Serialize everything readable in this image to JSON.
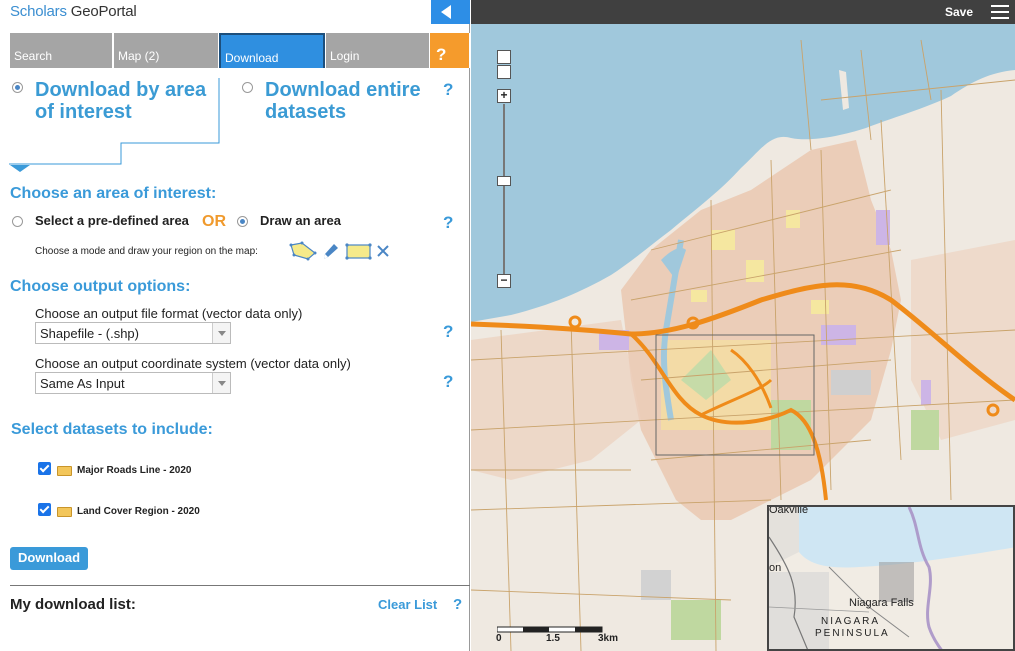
{
  "app": {
    "logo_part1": "Scholars",
    "logo_part2": " Geo",
    "logo_part3": "Portal"
  },
  "tabs": [
    {
      "label": "Search"
    },
    {
      "label": "Map (2)"
    },
    {
      "label": "Download"
    },
    {
      "label": "Login"
    },
    {
      "label": "?"
    }
  ],
  "download_mode": {
    "option1_line1": "Download by area",
    "option1_line2": "of interest",
    "option2_line1": "Download entire",
    "option2_line2": "datasets",
    "selected": "area"
  },
  "area": {
    "heading": "Choose an area of interest:",
    "predefined_label": "Select a pre-defined area",
    "or_label": "OR",
    "draw_label": "Draw an area",
    "mode_prompt": "Choose a mode and draw your region on the map:",
    "selected": "draw"
  },
  "output": {
    "heading": "Choose output options:",
    "format_label": "Choose an output file format (vector data only)",
    "format_value": "Shapefile - (.shp)",
    "crs_label": "Choose an output coordinate system (vector data only)",
    "crs_value": "Same As Input"
  },
  "datasets": {
    "heading": "Select datasets to include:",
    "items": [
      {
        "label": "Major Roads Line - 2020",
        "checked": true
      },
      {
        "label": "Land Cover Region - 2020",
        "checked": true
      }
    ]
  },
  "download_button": "Download",
  "download_list": {
    "title": "My download list:",
    "clear_label": "Clear List"
  },
  "help_glyph": "?",
  "map": {
    "save_label": "Save",
    "zoom_in": "+",
    "zoom_out": "−",
    "scale_labels": [
      "0",
      "1.5",
      "3km"
    ],
    "inset_labels": {
      "oakville": "Oakville",
      "on": "on",
      "niagara_falls": "Niagara Falls",
      "peninsula_line1": "NIAGARA",
      "peninsula_line2": "PENINSULA"
    },
    "colors": {
      "water": "#a0c8dc",
      "land": "#efe9e1",
      "urban": "#e9c7b2",
      "highway": "#ef8b1a"
    }
  }
}
